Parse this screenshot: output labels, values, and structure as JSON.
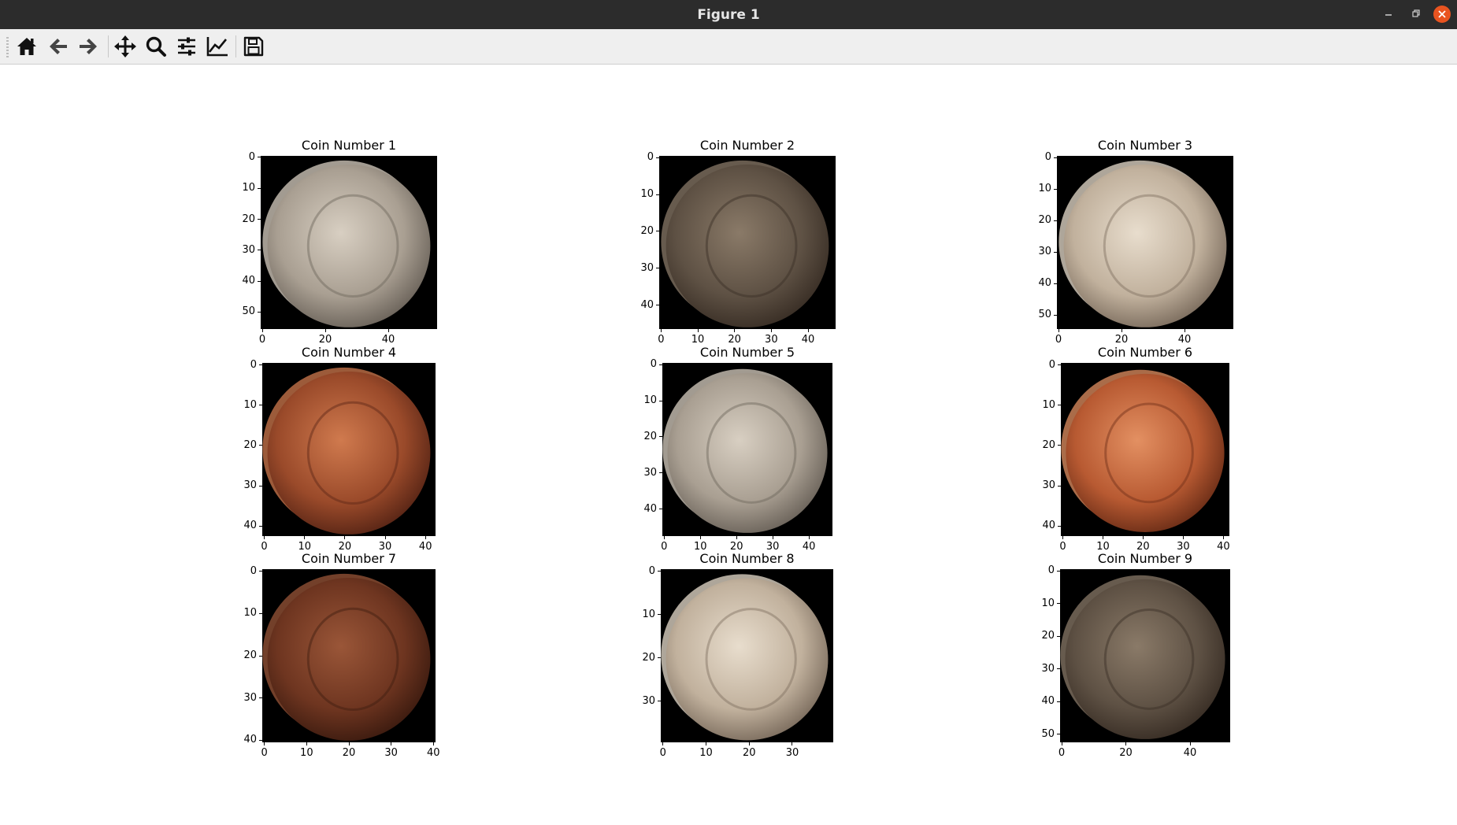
{
  "window": {
    "title": "Figure 1"
  },
  "toolbar": {
    "buttons": [
      {
        "name": "home-icon"
      },
      {
        "name": "back-arrow-icon"
      },
      {
        "name": "forward-arrow-icon"
      },
      {
        "name": "pan-move-icon"
      },
      {
        "name": "zoom-magnifier-icon"
      },
      {
        "name": "configure-subplots-icon"
      },
      {
        "name": "edit-axis-icon"
      },
      {
        "name": "save-floppy-icon"
      }
    ]
  },
  "colors": {
    "titlebar": "#2c2c2c",
    "close_button": "#e95420",
    "image_background": "#000000"
  },
  "subplots": [
    {
      "title": "Coin Number 1",
      "width": 56,
      "height": 56,
      "xticks": [
        0,
        20,
        40
      ],
      "yticks": [
        0,
        10,
        20,
        30,
        40,
        50
      ],
      "tone": "silver"
    },
    {
      "title": "Coin Number 2",
      "width": 48,
      "height": 47,
      "xticks": [
        0,
        10,
        20,
        30,
        40
      ],
      "yticks": [
        0,
        10,
        20,
        30,
        40
      ],
      "tone": "dark-grey"
    },
    {
      "title": "Coin Number 3",
      "width": 56,
      "height": 55,
      "xticks": [
        0,
        20,
        40
      ],
      "yticks": [
        0,
        10,
        20,
        30,
        40,
        50
      ],
      "tone": "light-silver"
    },
    {
      "title": "Coin Number 4",
      "width": 43,
      "height": 43,
      "xticks": [
        0,
        10,
        20,
        30,
        40
      ],
      "yticks": [
        0,
        10,
        20,
        30,
        40
      ],
      "tone": "copper"
    },
    {
      "title": "Coin Number 5",
      "width": 47,
      "height": 48,
      "xticks": [
        0,
        10,
        20,
        30,
        40
      ],
      "yticks": [
        0,
        10,
        20,
        30,
        40
      ],
      "tone": "silver"
    },
    {
      "title": "Coin Number 6",
      "width": 42,
      "height": 43,
      "xticks": [
        0,
        10,
        20,
        30,
        40
      ],
      "yticks": [
        0,
        10,
        20,
        30,
        40
      ],
      "tone": "bright-copper"
    },
    {
      "title": "Coin Number 7",
      "width": 41,
      "height": 41,
      "xticks": [
        0,
        10,
        20,
        30,
        40
      ],
      "yticks": [
        0,
        10,
        20,
        30,
        40
      ],
      "tone": "dark-copper"
    },
    {
      "title": "Coin Number 8",
      "width": 40,
      "height": 40,
      "xticks": [
        0,
        10,
        20,
        30
      ],
      "yticks": [
        0,
        10,
        20,
        30
      ],
      "tone": "light-silver"
    },
    {
      "title": "Coin Number 9",
      "width": 53,
      "height": 53,
      "xticks": [
        0,
        20,
        40
      ],
      "yticks": [
        0,
        10,
        20,
        30,
        40,
        50
      ],
      "tone": "dark-grey"
    }
  ]
}
